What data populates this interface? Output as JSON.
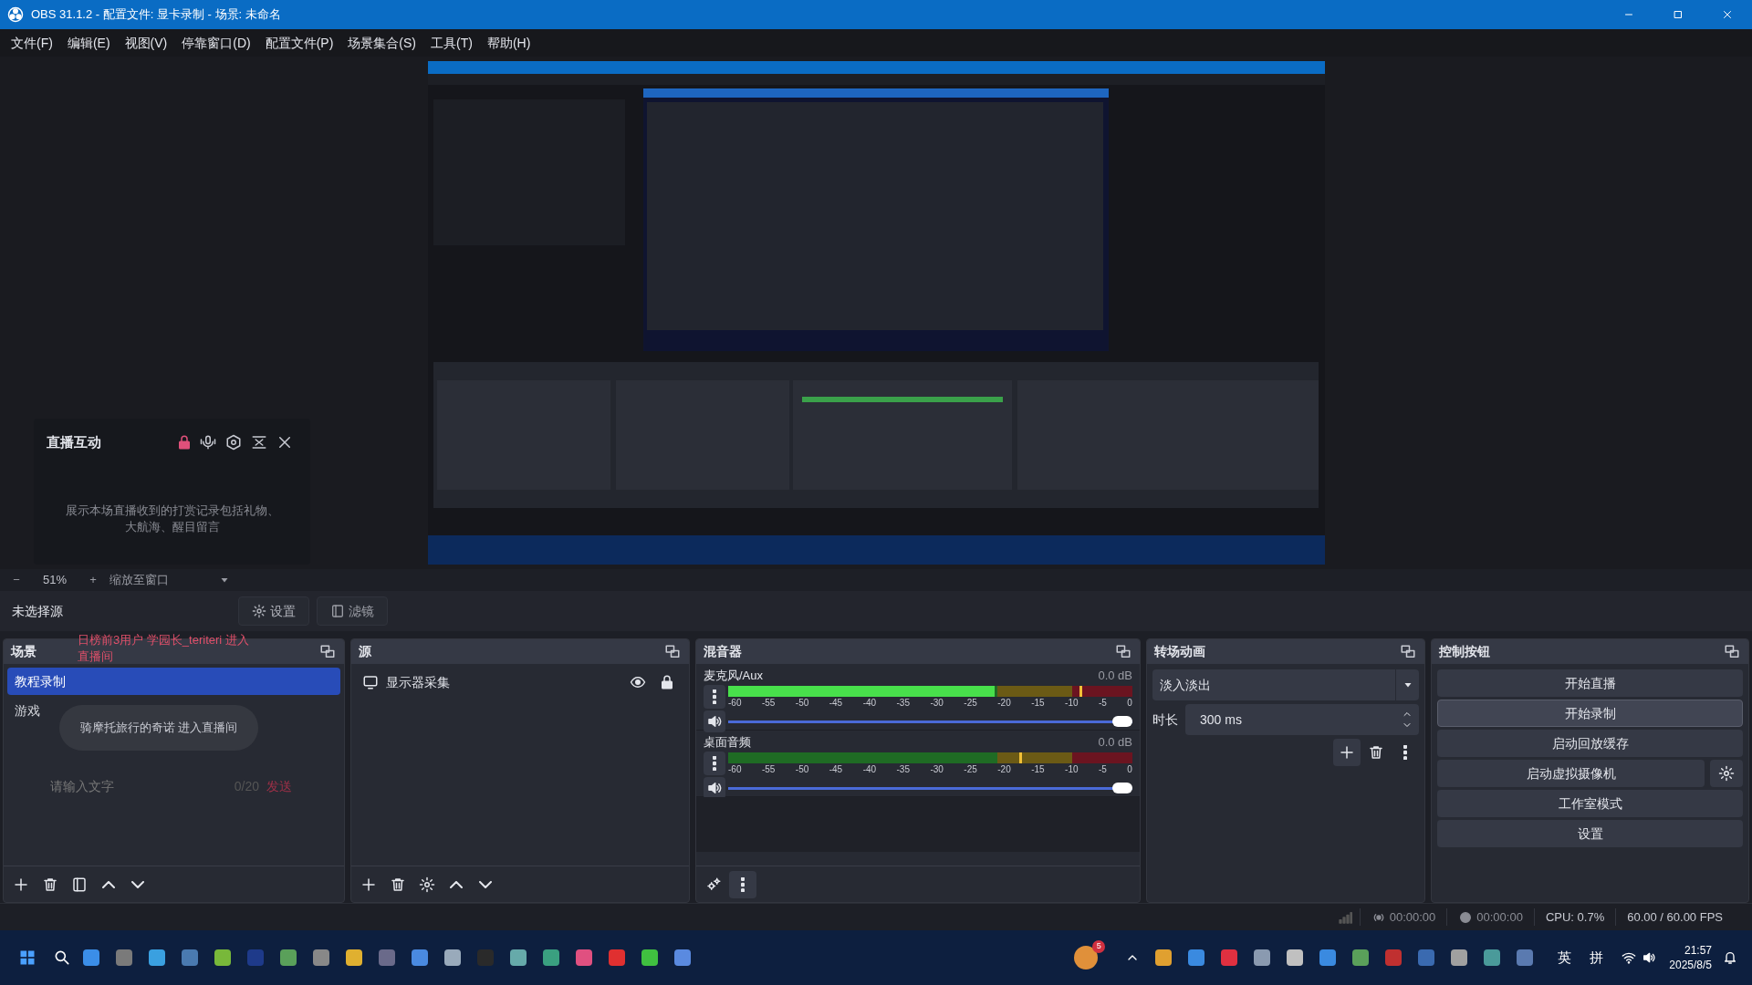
{
  "window": {
    "title": "OBS 31.1.2 - 配置文件: 显卡录制 - 场景: 未命名"
  },
  "menu": [
    "文件(F)",
    "编辑(E)",
    "视图(V)",
    "停靠窗口(D)",
    "配置文件(P)",
    "场景集合(S)",
    "工具(T)",
    "帮助(H)"
  ],
  "zoom_bar": {
    "zoom_out": "−",
    "zoom": "51%",
    "zoom_in": "+",
    "mode": "缩放至窗口"
  },
  "context_bar": {
    "label": "未选择源",
    "settings": "设置",
    "filters": "滤镜"
  },
  "scenes": {
    "title": "场景",
    "items": [
      {
        "name": "教程录制",
        "selected": true
      },
      {
        "name": "游戏",
        "selected": false
      }
    ]
  },
  "sources": {
    "title": "源",
    "items": [
      {
        "name": "显示器采集",
        "visible": true,
        "locked": true
      }
    ]
  },
  "mixer": {
    "title": "混音器",
    "channels": [
      {
        "name": "麦克风/Aux",
        "reading": "0.0 dB",
        "meter": {
          "level": 0.66
        },
        "peak": {
          "level": 0.87
        },
        "volume": {
          "level": 1
        },
        "scale": [
          "-60",
          "-55",
          "-50",
          "-45",
          "-40",
          "-35",
          "-30",
          "-25",
          "-20",
          "-15",
          "-10",
          "-5",
          "0"
        ]
      },
      {
        "name": "桌面音频",
        "reading": "0.0 dB",
        "meter": {
          "level": 0
        },
        "peak": {
          "level": 0.72
        },
        "volume": {
          "level": 1
        },
        "scale": [
          "-60",
          "-55",
          "-50",
          "-45",
          "-40",
          "-35",
          "-30",
          "-25",
          "-20",
          "-15",
          "-10",
          "-5",
          "0"
        ]
      }
    ]
  },
  "transitions": {
    "title": "转场动画",
    "transition": "淡入淡出",
    "duration_label": "时长",
    "duration": "300 ms"
  },
  "controls": {
    "title": "控制按钮",
    "buttons": [
      {
        "label": "开始直播",
        "kind": "plain",
        "hover": false
      },
      {
        "label": "开始录制",
        "kind": "plain",
        "hover": true
      },
      {
        "label": "启动回放缓存",
        "kind": "plain",
        "hover": false
      },
      {
        "label": "启动虚拟摄像机",
        "kind": "with_settings",
        "hover": false
      },
      {
        "label": "工作室模式",
        "kind": "plain",
        "hover": false
      },
      {
        "label": "设置",
        "kind": "plain",
        "hover": false
      }
    ]
  },
  "status_bar": {
    "stream_time": "00:00:00",
    "record_time": "00:00:00",
    "cpu": "CPU: 0.7%",
    "fps": "60.00 / 60.00 FPS"
  },
  "live_panel": {
    "title": "直播互动",
    "locked": true,
    "empty_text": "展示本场直播收到的打赏记录包括礼物、大航海、醒目留言",
    "notice": "日榜前3用户 学园长_teriteri 进入直播间",
    "entry": "骑摩托旅行的奇诺 进入直播间",
    "placeholder": "请输入文字",
    "counter": "0/20",
    "send": "发送"
  },
  "taskbar": {
    "weather_badge": "5",
    "ime": [
      "英",
      "拼"
    ],
    "time": "21:57",
    "date": "2025/8/5"
  }
}
